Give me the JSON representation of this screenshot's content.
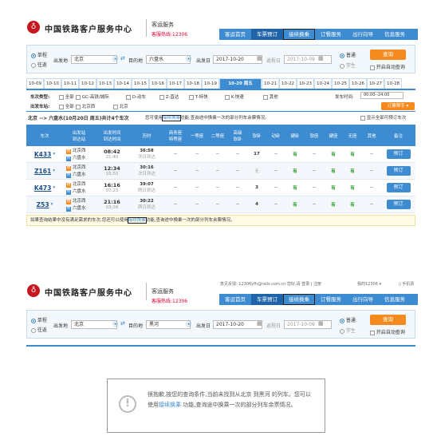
{
  "top": {
    "brand": "中国铁路客户服务中心",
    "sub": "客运服务",
    "hotline": "客服热线:12306",
    "nav": [
      "客运首页",
      "车票预订",
      "接续换乘",
      "订餐服务",
      "出行向导",
      "信息服务"
    ]
  },
  "search1": {
    "one_way": "单程",
    "round_trip": "往返",
    "from_label": "出发地",
    "from": "北京",
    "to_label": "目的地",
    "to": "六盘水",
    "date_label": "出发日",
    "date": "2017-10-20",
    "return_label": "返程日",
    "return_date": "2017-10-09",
    "normal": "普通",
    "student": "学生",
    "query": "查询",
    "auto_query": "开启自动查询"
  },
  "dates": [
    "10-09",
    "10-10",
    "10-11",
    "10-12",
    "10-13",
    "10-14",
    "10-15",
    "10-16",
    "10-17",
    "10-18",
    "10-19",
    "10-20 周五",
    "10-21",
    "10-22",
    "10-23",
    "10-24",
    "10-25",
    "10-26",
    "10-27",
    "10-28"
  ],
  "filters": {
    "type_label": "车次类型:",
    "all": "全部",
    "types": [
      "GC-高铁/城际",
      "D-动车",
      "Z-直达",
      "T-特快",
      "K-快速",
      "其他"
    ],
    "station_label": "出发车站:",
    "stations": [
      "全部",
      "北京西",
      "北京"
    ],
    "time_label": "发车时间:",
    "time_value": "00:00--24:00",
    "sort": "订票帮手 ▾"
  },
  "summary": {
    "route": "北京 --> 六盘水(10月20日 周五)共计4个车次",
    "tip_pre": "您可使用",
    "tip_link": "接续换乘",
    "tip_post": "功能,查询途中换乘一次的部分列车余票情况。",
    "show_all": "显示全部可预订车次"
  },
  "table": {
    "headers": [
      "车次",
      "出发站\n到达站",
      "出发时间\n到达时间",
      "历时",
      "商务座\n特等座",
      "一等座",
      "二等座",
      "高级\n软卧",
      "软卧",
      "动卧",
      "硬卧",
      "软座",
      "硬座",
      "无座",
      "其他",
      "备注"
    ],
    "rows": [
      {
        "no": "K433",
        "from": "北京西",
        "to": "六盘水",
        "dep": "08:42",
        "arr": "21:40",
        "dur": "36:58",
        "day": "次日到达",
        "cells": [
          "--",
          "--",
          "--",
          "--",
          "17",
          "--",
          "有",
          "--",
          "有",
          "有",
          "--"
        ],
        "book": "预订"
      },
      {
        "no": "Z161",
        "from": "北京西",
        "to": "六盘水",
        "dep": "12:34",
        "arr": "18:50",
        "dur": "30:16",
        "day": "次日到达",
        "cells": [
          "--",
          "--",
          "--",
          "--",
          "无",
          "--",
          "有",
          "--",
          "有",
          "有",
          "--"
        ],
        "book": "预订"
      },
      {
        "no": "K473",
        "from": "北京西",
        "to": "六盘水",
        "dep": "16:16",
        "arr": "07:23",
        "dur": "39:07",
        "day": "两日到达",
        "cells": [
          "--",
          "--",
          "--",
          "--",
          "3",
          "--",
          "有",
          "--",
          "有",
          "有",
          "--"
        ],
        "book": "预订"
      },
      {
        "no": "Z53",
        "from": "北京西",
        "to": "六盘水",
        "dep": "21:16",
        "arr": "03:38",
        "dur": "30:22",
        "day": "两日到达",
        "cells": [
          "--",
          "--",
          "--",
          "--",
          "4",
          "--",
          "有",
          "--",
          "有",
          "有",
          "--"
        ],
        "book": "预订"
      }
    ]
  },
  "notice": {
    "pre": "如果查询结果中没有满足需求的车次,您还可以使用",
    "link": "接续换乘",
    "post": "功能,查询途中换乘一次的部分列车余票情况。"
  },
  "header2": {
    "welcome": "意见反馈: 12306yfh@rails.com.cn  您好,请 登录 | 注册",
    "my": "我的12306 ▾",
    "mobile": "手机票"
  },
  "search2": {
    "from": "北京",
    "to": "黑河",
    "date": "2017-10-20",
    "return_date": "2017-10-09"
  },
  "message": {
    "pre": "很抱歉,按您的查询条件,当前未找到从北京 到黑河 的列车。您可以使用",
    "link": "接续换乘",
    "post": " 功能,查询途中换乘一次的部分列车余票情况。"
  }
}
